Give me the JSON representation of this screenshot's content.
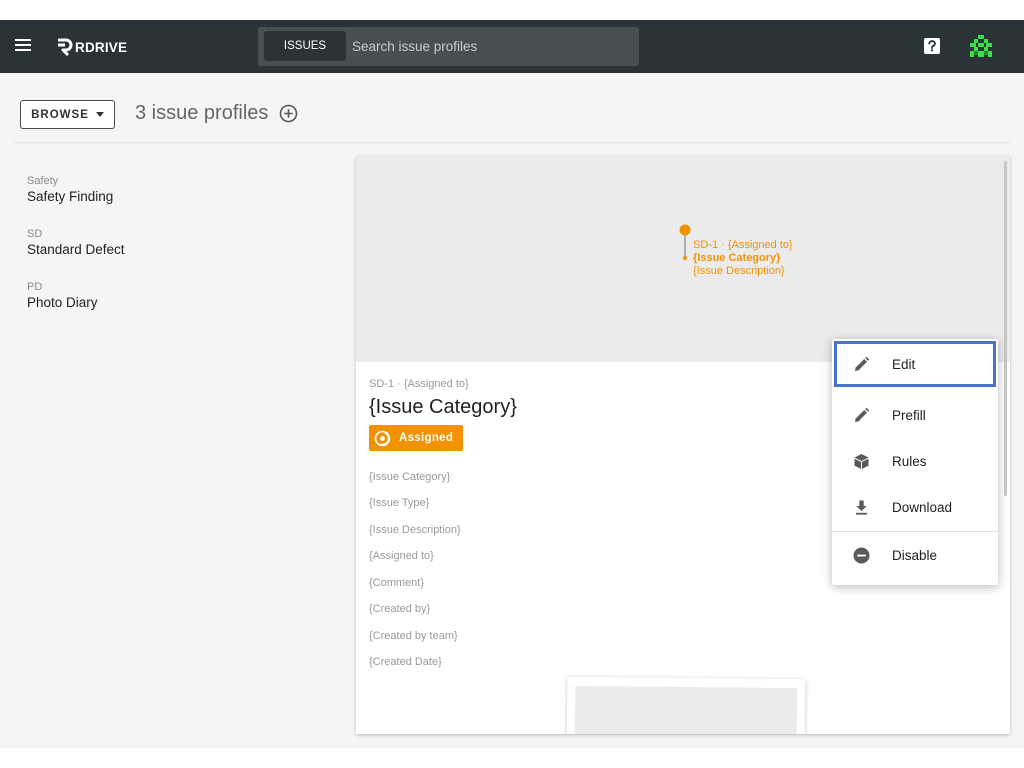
{
  "topbar": {
    "logo_text": "RDRIVE",
    "search_chip": "ISSUES",
    "search_placeholder": "Search issue profiles"
  },
  "toolbar": {
    "browse_label": "BROWSE",
    "count_title": "3 issue profiles"
  },
  "sidebar": {
    "items": [
      {
        "code": "Safety",
        "name": "Safety Finding"
      },
      {
        "code": "SD",
        "name": "Standard Defect"
      },
      {
        "code": "PD",
        "name": "Photo Diary"
      }
    ]
  },
  "preview": {
    "pin_line1": "SD-1 · {Assigned to}",
    "pin_line2": "{Issue Category}",
    "pin_line3": "{Issue Description}",
    "meta_line": "SD-1 · {Assigned to}",
    "title": "{Issue Category}",
    "status": "Assigned",
    "fields": [
      "{Issue Category}",
      "{Issue Type}",
      "{Issue Description}",
      "{Assigned to}",
      "{Comment}",
      "{Created by}",
      "{Created by team}",
      "{Created Date}"
    ]
  },
  "context_menu": {
    "items": [
      {
        "label": "Edit",
        "icon": "pencil-icon"
      },
      {
        "label": "Prefill",
        "icon": "pencil-icon"
      },
      {
        "label": "Rules",
        "icon": "cube-icon"
      },
      {
        "label": "Download",
        "icon": "download-icon"
      },
      {
        "label": "Disable",
        "icon": "minus-circle-icon"
      }
    ]
  },
  "colors": {
    "topbar": "#2a3437",
    "accent_orange": "#f39200",
    "focus_outline": "#4a74c9",
    "avatar_green": "#3ddc4a"
  }
}
